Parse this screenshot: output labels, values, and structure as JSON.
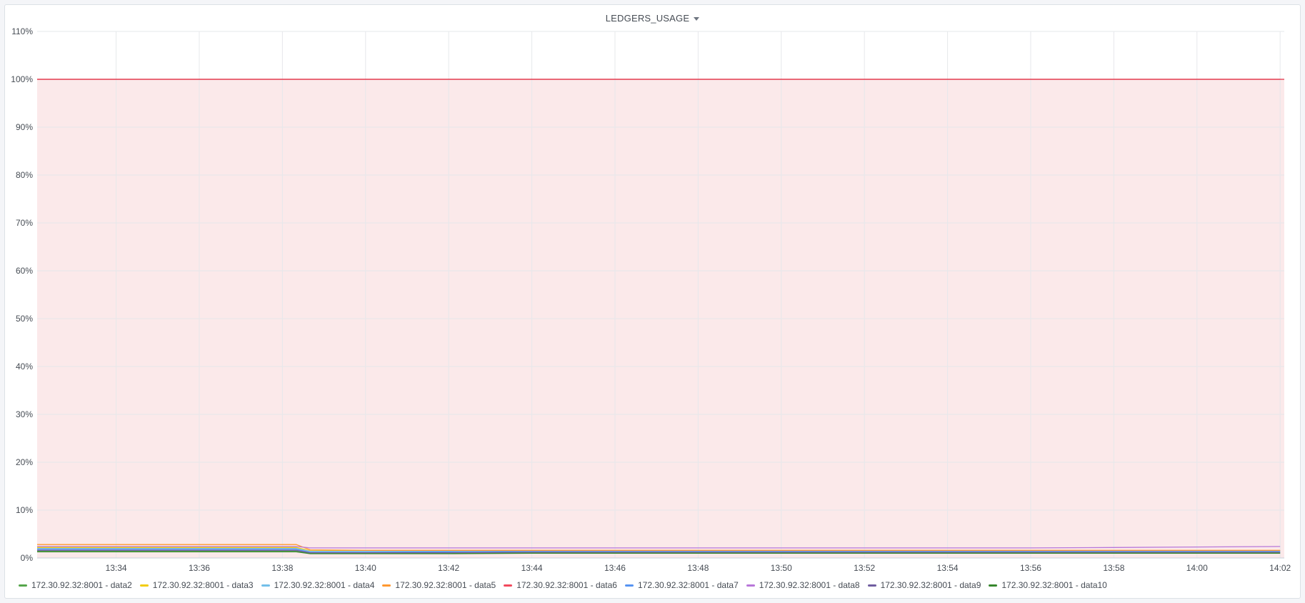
{
  "panel": {
    "title": "LEDGERS_USAGE",
    "menu_icon": "caret-down-icon"
  },
  "chart_data": {
    "type": "line",
    "title": "LEDGERS_USAGE",
    "xlabel": "",
    "ylabel": "",
    "x_ticks": [
      "13:34",
      "13:36",
      "13:38",
      "13:40",
      "13:42",
      "13:44",
      "13:46",
      "13:48",
      "13:50",
      "13:52",
      "13:54",
      "13:56",
      "13:58",
      "14:00",
      "14:02"
    ],
    "y_ticks": [
      "0%",
      "10%",
      "20%",
      "30%",
      "40%",
      "50%",
      "60%",
      "70%",
      "80%",
      "90%",
      "100%",
      "110%"
    ],
    "ylim": [
      0,
      110
    ],
    "xlim": [
      "13:32:06",
      "14:02:06"
    ],
    "grid": true,
    "legend_position": "bottom",
    "threshold": {
      "value": 100,
      "color": "#e02f44",
      "fill": "#fbe9ea"
    },
    "x": [
      "13:32",
      "13:34",
      "13:36",
      "13:38",
      "13:38:20",
      "13:38:40",
      "13:40",
      "13:42",
      "13:44",
      "13:46",
      "13:48",
      "13:50",
      "13:52",
      "13:54",
      "13:56",
      "13:58",
      "14:00",
      "14:02"
    ],
    "series": [
      {
        "name": "172.30.92.32:8001 - data2",
        "color": "#56a64b",
        "values": [
          1.5,
          1.5,
          1.5,
          1.5,
          1.5,
          1.0,
          1.0,
          1.0,
          1.1,
          1.1,
          1.1,
          1.1,
          1.1,
          1.1,
          1.1,
          1.1,
          1.1,
          1.1
        ]
      },
      {
        "name": "172.30.92.32:8001 - data3",
        "color": "#f2cc0c",
        "values": [
          2.2,
          2.2,
          2.2,
          2.2,
          2.2,
          1.5,
          1.5,
          1.5,
          1.5,
          1.5,
          1.5,
          1.5,
          1.5,
          1.5,
          1.5,
          1.5,
          1.5,
          1.5
        ]
      },
      {
        "name": "172.30.92.32:8001 - data4",
        "color": "#73bfe9",
        "values": [
          2.0,
          2.0,
          2.0,
          2.0,
          2.0,
          1.4,
          1.4,
          1.4,
          1.5,
          1.5,
          1.5,
          1.5,
          1.5,
          1.5,
          1.5,
          1.5,
          1.5,
          1.5
        ]
      },
      {
        "name": "172.30.92.32:8001 - data5",
        "color": "#ff9830",
        "values": [
          2.8,
          2.8,
          2.8,
          2.8,
          2.8,
          1.7,
          1.6,
          1.6,
          1.6,
          1.6,
          1.6,
          1.6,
          1.6,
          1.6,
          1.6,
          1.6,
          1.6,
          1.6
        ]
      },
      {
        "name": "172.30.92.32:8001 - data6",
        "color": "#f2495c",
        "values": [
          100,
          100,
          100,
          100,
          100,
          100,
          100,
          100,
          100,
          100,
          100,
          100,
          100,
          100,
          100,
          100,
          100,
          100
        ]
      },
      {
        "name": "172.30.92.32:8001 - data7",
        "color": "#5794f2",
        "values": [
          1.8,
          1.8,
          1.8,
          1.8,
          1.8,
          1.2,
          1.2,
          1.3,
          1.4,
          1.4,
          1.4,
          1.4,
          1.4,
          1.4,
          1.4,
          1.4,
          1.4,
          1.4
        ]
      },
      {
        "name": "172.30.92.32:8001 - data8",
        "color": "#b877d9",
        "values": [
          2.4,
          2.4,
          2.4,
          2.4,
          2.4,
          2.1,
          2.1,
          2.1,
          2.1,
          2.1,
          2.1,
          2.1,
          2.1,
          2.1,
          2.1,
          2.2,
          2.3,
          2.4
        ]
      },
      {
        "name": "172.30.92.32:8001 - data9",
        "color": "#705da0",
        "values": [
          1.6,
          1.6,
          1.6,
          1.6,
          1.6,
          1.1,
          1.1,
          1.1,
          1.2,
          1.2,
          1.2,
          1.2,
          1.2,
          1.2,
          1.2,
          1.2,
          1.2,
          1.2
        ]
      },
      {
        "name": "172.30.92.32:8001 - data10",
        "color": "#37872d",
        "values": [
          1.3,
          1.3,
          1.3,
          1.3,
          1.3,
          0.9,
          0.9,
          0.9,
          1.0,
          1.0,
          1.0,
          1.0,
          1.0,
          1.0,
          1.0,
          1.0,
          1.0,
          1.0
        ]
      }
    ]
  },
  "legend_items": [
    {
      "label": "172.30.92.32:8001 - data2",
      "color": "#56a64b"
    },
    {
      "label": "172.30.92.32:8001 - data3",
      "color": "#f2cc0c"
    },
    {
      "label": "172.30.92.32:8001 - data4",
      "color": "#73bfe9"
    },
    {
      "label": "172.30.92.32:8001 - data5",
      "color": "#ff9830"
    },
    {
      "label": "172.30.92.32:8001 - data6",
      "color": "#f2495c"
    },
    {
      "label": "172.30.92.32:8001 - data7",
      "color": "#5794f2"
    },
    {
      "label": "172.30.92.32:8001 - data8",
      "color": "#b877d9"
    },
    {
      "label": "172.30.92.32:8001 - data9",
      "color": "#705da0"
    },
    {
      "label": "172.30.92.32:8001 - data10",
      "color": "#37872d"
    }
  ]
}
